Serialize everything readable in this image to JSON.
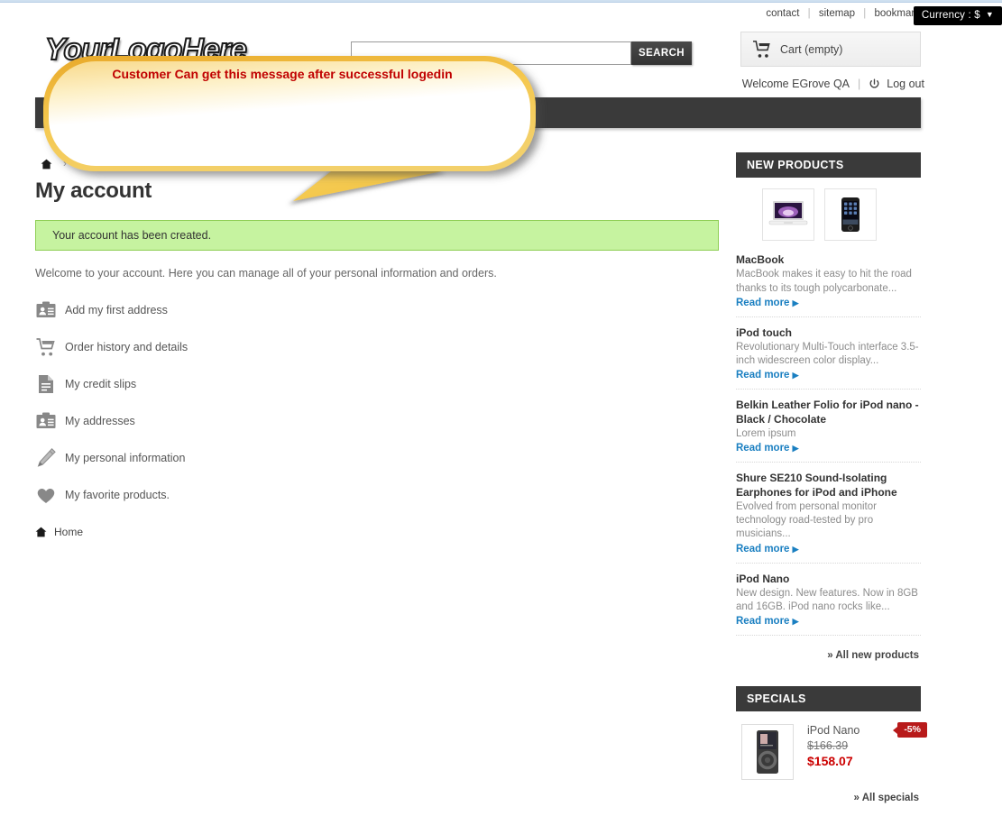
{
  "header": {
    "logo_text": "YourLogoHere",
    "top_links": [
      {
        "label": "contact"
      },
      {
        "label": "sitemap"
      },
      {
        "label": "bookmark"
      }
    ],
    "currency_label": "Currency : $",
    "currency_caret": "▼",
    "search_placeholder": "",
    "search_value": "",
    "search_button_label": "SEARCH",
    "cart_label": "Cart (empty)",
    "welcome_text": "Welcome EGrove QA",
    "logout_label": "Log out"
  },
  "breadcrumb": {
    "home_label": "",
    "separator": "›"
  },
  "main": {
    "page_title": "My account",
    "success_message": "Your account has been created.",
    "welcome_paragraph": "Welcome to your account. Here you can manage all of your personal information and orders.",
    "account_links": [
      {
        "label": "Add my first address",
        "icon": "address-card-icon"
      },
      {
        "label": "Order history and details",
        "icon": "shopping-cart-icon"
      },
      {
        "label": "My credit slips",
        "icon": "document-icon"
      },
      {
        "label": "My addresses",
        "icon": "address-card-icon"
      },
      {
        "label": "My personal information",
        "icon": "pencil-icon"
      },
      {
        "label": "My favorite products.",
        "icon": "heart-icon"
      }
    ],
    "home_link_label": "Home"
  },
  "right_column": {
    "new_products": {
      "title": "NEW PRODUCTS",
      "thumbnails": [
        {
          "alt": "MacBook thumbnail"
        },
        {
          "alt": "iPhone thumbnail"
        }
      ],
      "items": [
        {
          "name": "MacBook",
          "description": "MacBook makes it easy to hit the road thanks to its tough polycarbonate...",
          "read_more": "Read more"
        },
        {
          "name": "iPod touch",
          "description": "Revolutionary Multi-Touch interface 3.5-inch widescreen color display...",
          "read_more": "Read more"
        },
        {
          "name": "Belkin Leather Folio for iPod nano - Black / Chocolate",
          "description": "Lorem ipsum",
          "read_more": "Read more"
        },
        {
          "name": "Shure SE210 Sound-Isolating Earphones for iPod and iPhone",
          "description": "Evolved from personal monitor technology road-tested by pro musicians...",
          "read_more": "Read more"
        },
        {
          "name": "iPod Nano",
          "description": "New design. New features. Now in 8GB and 16GB. iPod nano rocks like...",
          "read_more": "Read more"
        }
      ],
      "all_link": "» All new products"
    },
    "specials": {
      "title": "SPECIALS",
      "product_name": "iPod Nano",
      "old_price": "$166.39",
      "new_price": "$158.07",
      "discount_badge": "-5%",
      "all_link": "» All specials"
    }
  },
  "callout": {
    "message": "Customer Can get this message after successful logedin",
    "border_color": "#f2c14a",
    "text_color": "#c00000"
  }
}
